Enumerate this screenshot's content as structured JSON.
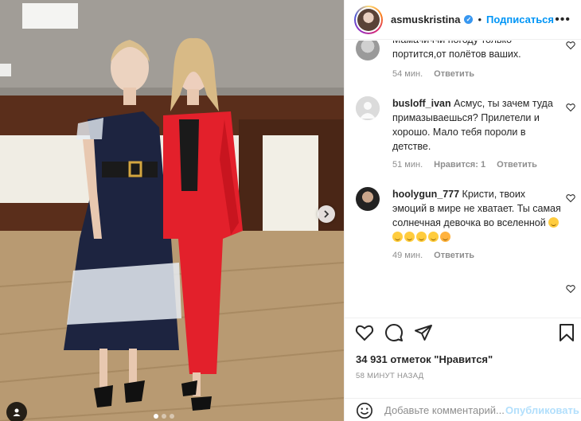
{
  "post": {
    "image_alt": "Two women standing in a dance hall",
    "carousel": {
      "total": 3,
      "active": 1
    }
  },
  "header": {
    "username": "asmuskristina",
    "separator": "•",
    "follow_label": "Подписаться",
    "more_icon": "more-horizontal-icon",
    "verified_icon": "verified-badge-icon"
  },
  "comments": [
    {
      "username": "",
      "text": "Мамачиччи погоду только портится,от полётов ваших.",
      "time": "54 мин.",
      "likes": "",
      "reply": "Ответить"
    },
    {
      "username": "busloff_ivan",
      "text": "Асмус, ты зачем туда примазываешься? Прилетели и хорошо. Мало тебя пороли в детстве.",
      "time": "51 мин.",
      "likes": "Нравится: 1",
      "reply": "Ответить"
    },
    {
      "username": "hoolygun_777",
      "text": "Кристи, твоих эмоций в мире не хватает. Ты самая солнечная девочка во вселенной",
      "time": "49 мин.",
      "likes": "",
      "reply": "Ответить"
    }
  ],
  "actions": {
    "like_icon": "heart-icon",
    "comment_icon": "comment-icon",
    "share_icon": "paper-plane-icon",
    "save_icon": "bookmark-icon",
    "likes_text": "34 931 отметок \"Нравится\"",
    "timestamp": "58 МИНУТ НАЗАД"
  },
  "composer": {
    "placeholder": "Добавьте комментарий...",
    "publish_label": "Опубликовать"
  },
  "colors": {
    "accent": "#0095f6",
    "publish_disabled": "#b2dffc",
    "muted": "#8e8e8e"
  }
}
